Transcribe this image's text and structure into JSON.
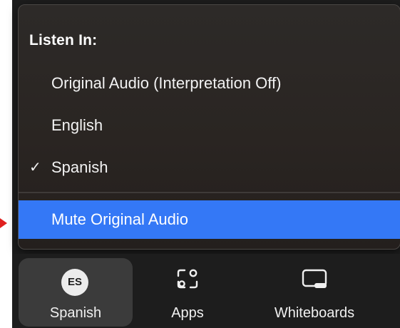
{
  "menu": {
    "heading": "Listen In:",
    "items": [
      {
        "label": "Original Audio (Interpretation Off)",
        "checked": false
      },
      {
        "label": "English",
        "checked": false
      },
      {
        "label": "Spanish",
        "checked": true
      }
    ],
    "check_glyph": "✓",
    "mute_label": "Mute Original Audio"
  },
  "toolbar": {
    "items": [
      {
        "label": "Spanish",
        "avatar_text": "ES",
        "icon": "language-avatar",
        "active": true
      },
      {
        "label": "Apps",
        "icon": "apps-icon",
        "active": false
      },
      {
        "label": "Whiteboards",
        "icon": "whiteboard-icon",
        "active": false
      }
    ]
  },
  "colors": {
    "menu_bg": "#2a2522",
    "highlight": "#3478f6",
    "toolbar_bg": "#1d1d1d",
    "active_tool_bg": "#3b3b3b",
    "pointer_arrow": "#e0201f"
  }
}
